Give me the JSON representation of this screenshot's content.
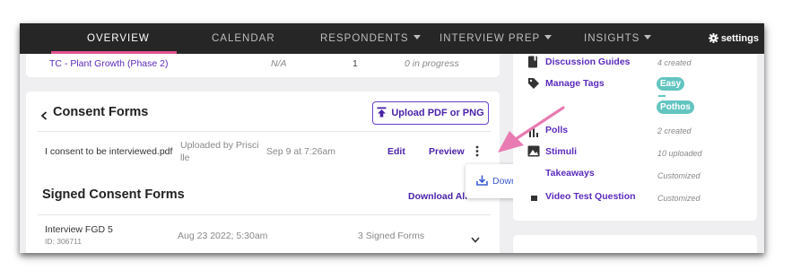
{
  "nav": {
    "items": [
      {
        "label": "OVERVIEW"
      },
      {
        "label": "CALENDAR"
      },
      {
        "label": "RESPONDENTS"
      },
      {
        "label": "INTERVIEW PREP"
      },
      {
        "label": "INSIGHTS"
      }
    ],
    "settings_label": "settings"
  },
  "top_row": {
    "name": "TC - Plant Growth (Phase 2)",
    "col2": "N/A",
    "col3": "1",
    "status": "0 in progress"
  },
  "consent": {
    "title": "Consent Forms",
    "upload_label": "Upload PDF or PNG",
    "file": {
      "name": "I consent to be interviewed.pdf",
      "uploaded_by_line1": "Uploaded by Prisci",
      "uploaded_by_line2": "lle",
      "date": "Sep 9 at 7:26am",
      "edit_label": "Edit",
      "preview_label": "Preview"
    },
    "menu": {
      "download_label": "Download"
    }
  },
  "signed": {
    "title": "Signed Consent Forms",
    "download_all_label": "Download All",
    "row": {
      "name": "Interview FGD 5",
      "id": "ID: 306711",
      "date": "Aug 23 2022; 5:30am",
      "count": "3 Signed Forms"
    }
  },
  "sidebar": {
    "items": [
      {
        "label": "Discussion Guides",
        "meta": "4 created"
      },
      {
        "label": "Manage Tags",
        "meta": ""
      },
      {
        "label": "Polls",
        "meta": "2 created"
      },
      {
        "label": "Stimuli",
        "meta": "10 uploaded"
      },
      {
        "label": "Takeaways",
        "meta": "Customized"
      },
      {
        "label": "Video Test Question",
        "meta": "Customized"
      }
    ],
    "tags": [
      "Easy",
      "Pothos"
    ]
  },
  "colors": {
    "accent": "#5b2bbd",
    "nav_bg": "#262626",
    "nav_underline": "#e0528e",
    "badge": "#63c5c0",
    "annotation_arrow": "#e87bb1"
  }
}
